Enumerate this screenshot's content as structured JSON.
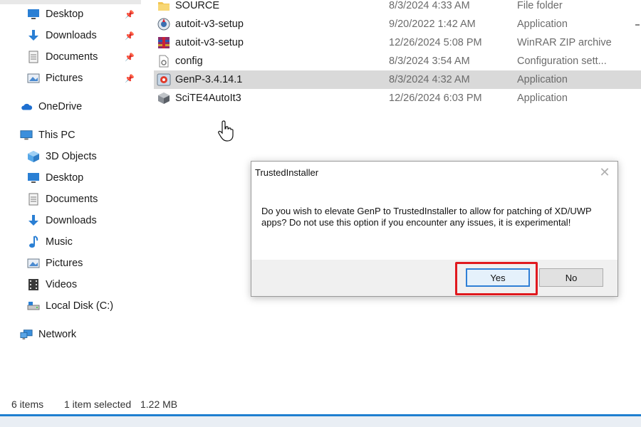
{
  "sidebar": {
    "items": [
      {
        "label": "Desktop",
        "icon": "desktop-icon",
        "pinned": true
      },
      {
        "label": "Downloads",
        "icon": "downloads-icon",
        "pinned": true
      },
      {
        "label": "Documents",
        "icon": "documents-icon",
        "pinned": true
      },
      {
        "label": "Pictures",
        "icon": "pictures-icon",
        "pinned": true
      },
      {
        "label": "OneDrive",
        "icon": "onedrive-icon",
        "pinned": false
      },
      {
        "label": "This PC",
        "icon": "this-pc-icon",
        "pinned": false
      },
      {
        "label": "3D Objects",
        "icon": "3d-objects-icon",
        "pinned": false
      },
      {
        "label": "Desktop",
        "icon": "desktop-icon",
        "pinned": false
      },
      {
        "label": "Documents",
        "icon": "documents-icon",
        "pinned": false
      },
      {
        "label": "Downloads",
        "icon": "downloads-icon",
        "pinned": false
      },
      {
        "label": "Music",
        "icon": "music-icon",
        "pinned": false
      },
      {
        "label": "Pictures",
        "icon": "pictures-icon",
        "pinned": false
      },
      {
        "label": "Videos",
        "icon": "videos-icon",
        "pinned": false
      },
      {
        "label": "Local Disk (C:)",
        "icon": "local-disk-icon",
        "pinned": false
      },
      {
        "label": "Network",
        "icon": "network-icon",
        "pinned": false
      }
    ]
  },
  "files": [
    {
      "name": "SOURCE",
      "date": "8/3/2024 4:33 AM",
      "type": "File folder",
      "icon": "folder-icon",
      "selected": false
    },
    {
      "name": "autoit-v3-setup",
      "date": "9/20/2022 1:42 AM",
      "type": "Application",
      "icon": "autoit-setup-icon",
      "selected": false
    },
    {
      "name": "autoit-v3-setup",
      "date": "12/26/2024 5:08 PM",
      "type": "WinRAR ZIP archive",
      "icon": "winrar-icon",
      "selected": false
    },
    {
      "name": "config",
      "date": "8/3/2024 3:54 AM",
      "type": "Configuration sett...",
      "icon": "config-file-icon",
      "selected": false
    },
    {
      "name": "GenP-3.4.14.1",
      "date": "8/3/2024 4:32 AM",
      "type": "Application",
      "icon": "genp-app-icon",
      "selected": true
    },
    {
      "name": "SciTE4AutoIt3",
      "date": "12/26/2024 6:03 PM",
      "type": "Application",
      "icon": "scite-icon",
      "selected": false
    }
  ],
  "status": {
    "items_count": "6 items",
    "selection": "1 item selected",
    "size": "1.22 MB"
  },
  "dialog": {
    "title": "TrustedInstaller",
    "message": "Do you wish to elevate GenP to TrustedInstaller to allow for patching of XD/UWP apps? Do not use this option if you encounter any issues, it is experimental!",
    "yes_label": "Yes",
    "no_label": "No"
  },
  "colors": {
    "accent": "#1e7fd0",
    "highlight_box": "#e0191e",
    "selected_row": "#d9d9d9"
  }
}
